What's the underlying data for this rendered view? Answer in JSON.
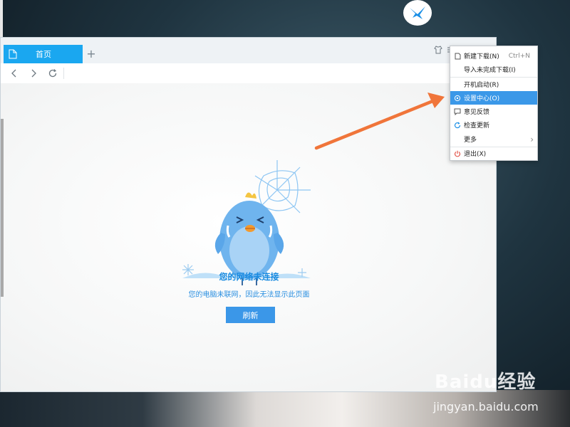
{
  "browser": {
    "tab_label": "首页",
    "new_tab_symbol": "+"
  },
  "error_page": {
    "title": "您的网络未连接",
    "subtitle": "您的电脑未联网，因此无法显示此页面",
    "refresh_label": "刷新"
  },
  "menu": {
    "items": [
      {
        "label": "新建下载(N)",
        "shortcut": "Ctrl+N",
        "icon": "new-download-icon"
      },
      {
        "label": "导入未完成下载(I)",
        "shortcut": "",
        "icon": ""
      },
      {
        "label": "开机启动(R)",
        "shortcut": "",
        "icon": ""
      },
      {
        "label": "设置中心(O)",
        "shortcut": "",
        "icon": "settings-icon",
        "highlighted": true
      },
      {
        "label": "意见反馈",
        "shortcut": "",
        "icon": "feedback-icon"
      },
      {
        "label": "检查更新",
        "shortcut": "",
        "icon": "refresh-icon"
      },
      {
        "label": "更多",
        "shortcut": "",
        "icon": "",
        "submenu_symbol": "›"
      },
      {
        "label": "退出(X)",
        "shortcut": "",
        "icon": "power-icon"
      }
    ]
  },
  "watermark": {
    "brand": "Baidu经验",
    "url": "jingyan.baidu.com"
  },
  "colors": {
    "accent": "#1aa7f0",
    "menu_highlight": "#3b98e8",
    "arrow": "#f0753a",
    "error_text": "#1a8be0"
  }
}
